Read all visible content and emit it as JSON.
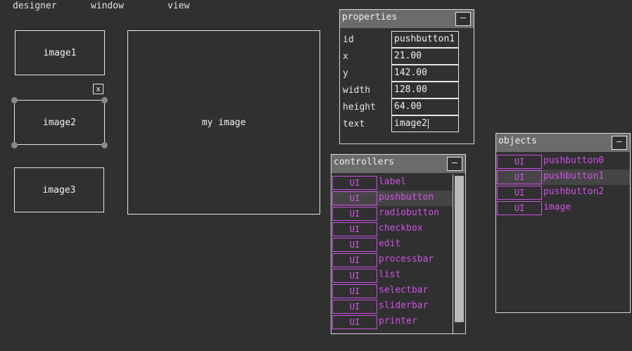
{
  "menu": {
    "items": [
      "designer",
      "window",
      "view"
    ]
  },
  "canvas": {
    "image1": "image1",
    "image2": "image2",
    "image3": "image3",
    "main_image": "my image",
    "delete_label": "x"
  },
  "properties": {
    "title": "properties",
    "minimize_label": "–",
    "fields": [
      {
        "label": "id",
        "value": "pushbutton1"
      },
      {
        "label": "x",
        "value": "21.00"
      },
      {
        "label": "y",
        "value": "142.00"
      },
      {
        "label": "width",
        "value": "128.00"
      },
      {
        "label": "height",
        "value": "64.00"
      },
      {
        "label": "text",
        "value": "image2"
      }
    ]
  },
  "controllers": {
    "title": "controllers",
    "minimize_label": "–",
    "items": [
      {
        "tag": "UI",
        "label": "label"
      },
      {
        "tag": "UI",
        "label": "pushbutton",
        "selected": true
      },
      {
        "tag": "UI",
        "label": "radiobutton"
      },
      {
        "tag": "UI",
        "label": "checkbox"
      },
      {
        "tag": "UI",
        "label": "edit"
      },
      {
        "tag": "UI",
        "label": "processbar"
      },
      {
        "tag": "UI",
        "label": "list"
      },
      {
        "tag": "UI",
        "label": "selectbar"
      },
      {
        "tag": "UI",
        "label": "sliderbar"
      },
      {
        "tag": "UI",
        "label": "printer"
      }
    ]
  },
  "objects": {
    "title": "objects",
    "minimize_label": "–",
    "items": [
      {
        "tag": "UI",
        "label": "pushbutton0"
      },
      {
        "tag": "UI",
        "label": "pushbutton1",
        "selected": true
      },
      {
        "tag": "UI",
        "label": "pushbutton2"
      },
      {
        "tag": "UI",
        "label": "image"
      }
    ]
  },
  "colors": {
    "background": "#303030",
    "panel_header": "#6b6b6b",
    "accent_purple": "#cf53e6",
    "selection_row": "#454545",
    "handle": "#8a8a8a"
  }
}
